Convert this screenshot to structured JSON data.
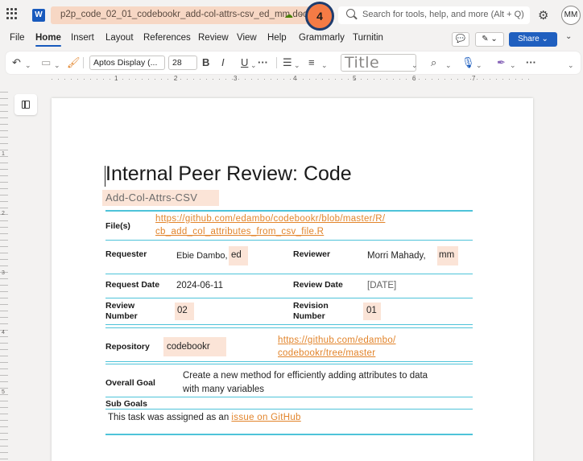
{
  "titlebar": {
    "document_name": "p2p_code_02_01_codebookr_add-col-attrs-csv_ed_mm.docx",
    "step_number": "4",
    "search_placeholder": "Search for tools, help, and more (Alt + Q)",
    "user_initials": "MM",
    "app_icon": "word-icon"
  },
  "menu": {
    "tabs": [
      "File",
      "Home",
      "Insert",
      "Layout",
      "References",
      "Review",
      "View",
      "Help",
      "Grammarly",
      "Turnitin"
    ],
    "active_tab": "Home",
    "share_label": "Share"
  },
  "ribbon": {
    "font_name": "Aptos Display (...",
    "font_size": "28",
    "bold": "B",
    "italic": "I",
    "underline": "U",
    "style_name": "Title"
  },
  "ruler": {
    "marks": [
      "1",
      "2",
      "3",
      "4",
      "5",
      "6",
      "7"
    ],
    "vertical_marks": [
      "1",
      "2",
      "3",
      "4",
      "5"
    ]
  },
  "document": {
    "title": "Internal Peer Review: Code",
    "subtitle": "Add-Col-Attrs-CSV",
    "files_label": "File(s)",
    "files_link_line1": "https://github.com/edambo/codebookr/blob/master/R/",
    "files_link_line2": "cb_add_col_attributes_from_csv_file.R",
    "requester_label": "Requester",
    "requester_name": "Ebie Dambo,",
    "requester_initials": "ed",
    "reviewer_label": "Reviewer",
    "reviewer_name": "Morri Mahady,",
    "reviewer_initials": "mm",
    "request_date_label": "Request Date",
    "request_date": "2024-06-11",
    "review_date_label": "Review Date",
    "review_date": "[DATE]",
    "review_number_label_line1": "Review",
    "review_number_label_line2": "Number",
    "review_number": "02",
    "revision_number_label_line1": "Revision",
    "revision_number_label_line2": "Number",
    "revision_number": "01",
    "repository_label": "Repository",
    "repository_name": "codebookr",
    "repository_link_line1": "https://github.com/edambo/",
    "repository_link_line2": "codebookr/tree/master",
    "overall_goal_label": "Overall Goal",
    "overall_goal_line1": "Create a new method for efficiently adding attributes to data",
    "overall_goal_line2": "with many variables",
    "sub_goals_label": "Sub Goals",
    "sub_goal_text": "This task was assigned as an",
    "sub_goal_link": "issue on GitHub"
  },
  "colors": {
    "accent_line": "#4ec3d9",
    "highlight": "#fbe4d7",
    "link": "#e2842b",
    "share_button": "#1f5fbf",
    "step_badge": "#f47b45"
  }
}
